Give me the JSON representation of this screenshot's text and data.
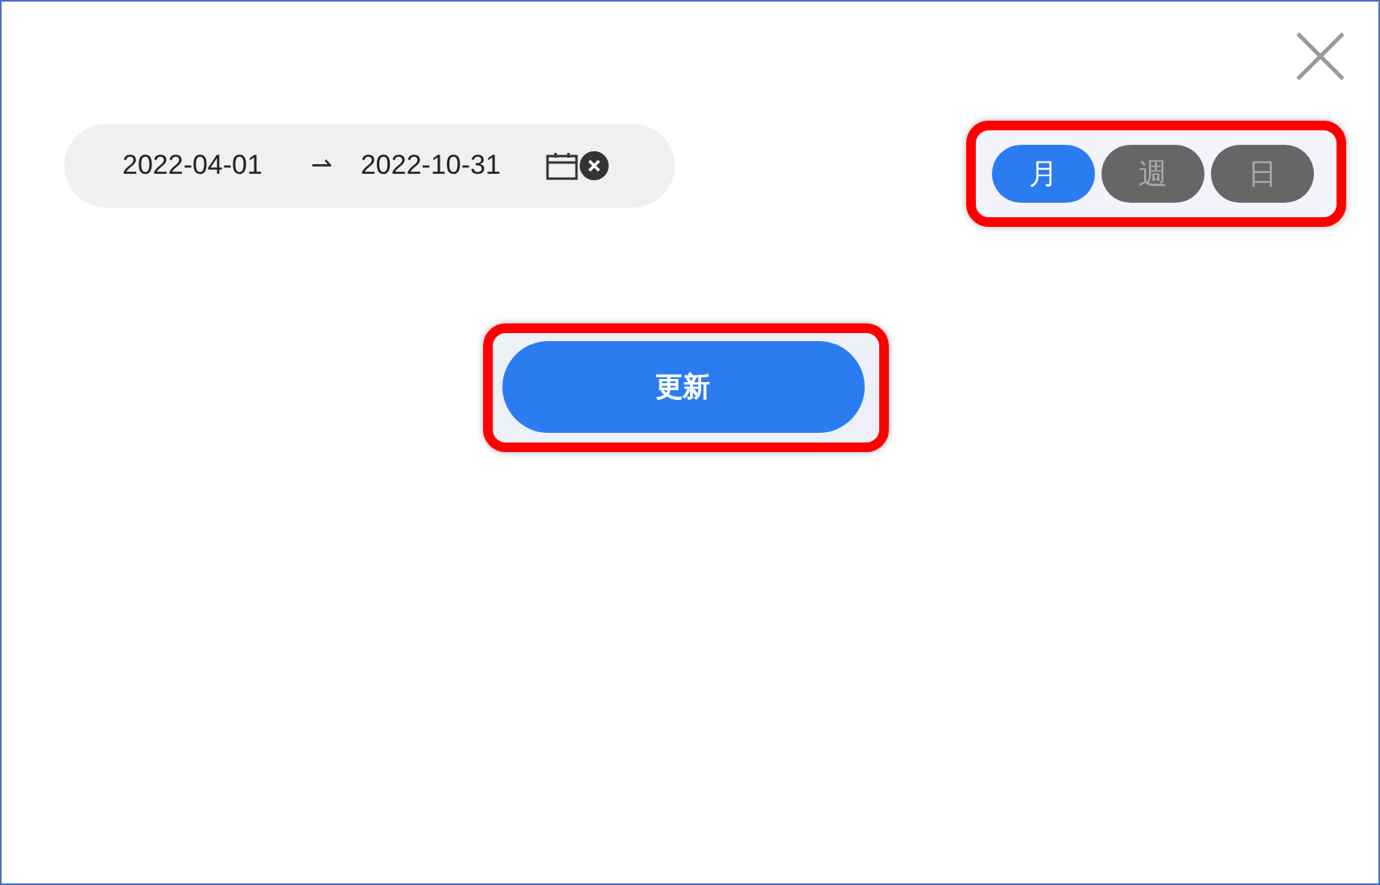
{
  "date_range": {
    "start": "2022-04-01",
    "separator": "⇀",
    "end": "2022-10-31"
  },
  "period_tabs": [
    {
      "label": "月",
      "selected": true
    },
    {
      "label": "週",
      "selected": false
    },
    {
      "label": "日",
      "selected": false
    }
  ],
  "update_button": {
    "label": "更新"
  }
}
